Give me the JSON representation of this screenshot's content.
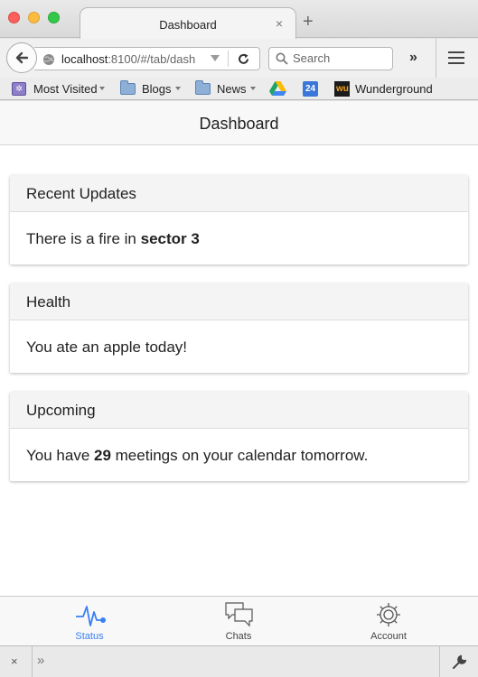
{
  "browser": {
    "tab": {
      "title": "Dashboard",
      "close": "×"
    },
    "new_tab": "+",
    "url": {
      "host": "localhost",
      "rest": ":8100/#/tab/dash"
    },
    "search": {
      "placeholder": "Search"
    },
    "overflow": "»",
    "bookmarks": [
      {
        "label": "Most Visited",
        "icon": "most-visited-icon"
      },
      {
        "label": "Blogs",
        "icon": "folder-icon"
      },
      {
        "label": "News",
        "icon": "folder-icon"
      },
      {
        "label": "",
        "icon": "google-drive-icon"
      },
      {
        "label": "24",
        "icon": "calendar-icon"
      },
      {
        "label": "Wunderground",
        "icon": "wunderground-icon",
        "icon_text": "wu"
      }
    ]
  },
  "app": {
    "title": "Dashboard",
    "cards": [
      {
        "header": "Recent Updates",
        "body_prefix": "There is a fire in ",
        "body_bold": "sector 3",
        "body_suffix": ""
      },
      {
        "header": "Health",
        "body_prefix": "You ate an apple today!",
        "body_bold": "",
        "body_suffix": ""
      },
      {
        "header": "Upcoming",
        "body_prefix": "You have ",
        "body_bold": "29",
        "body_suffix": " meetings on your calendar tomorrow."
      }
    ],
    "tabs": [
      {
        "label": "Status",
        "icon": "pulse-icon",
        "active": true
      },
      {
        "label": "Chats",
        "icon": "chat-bubbles-icon",
        "active": false
      },
      {
        "label": "Account",
        "icon": "gear-icon",
        "active": false
      }
    ],
    "accent_color": "#387ef5"
  },
  "addon_bar": {
    "close": "×",
    "more": "»"
  }
}
